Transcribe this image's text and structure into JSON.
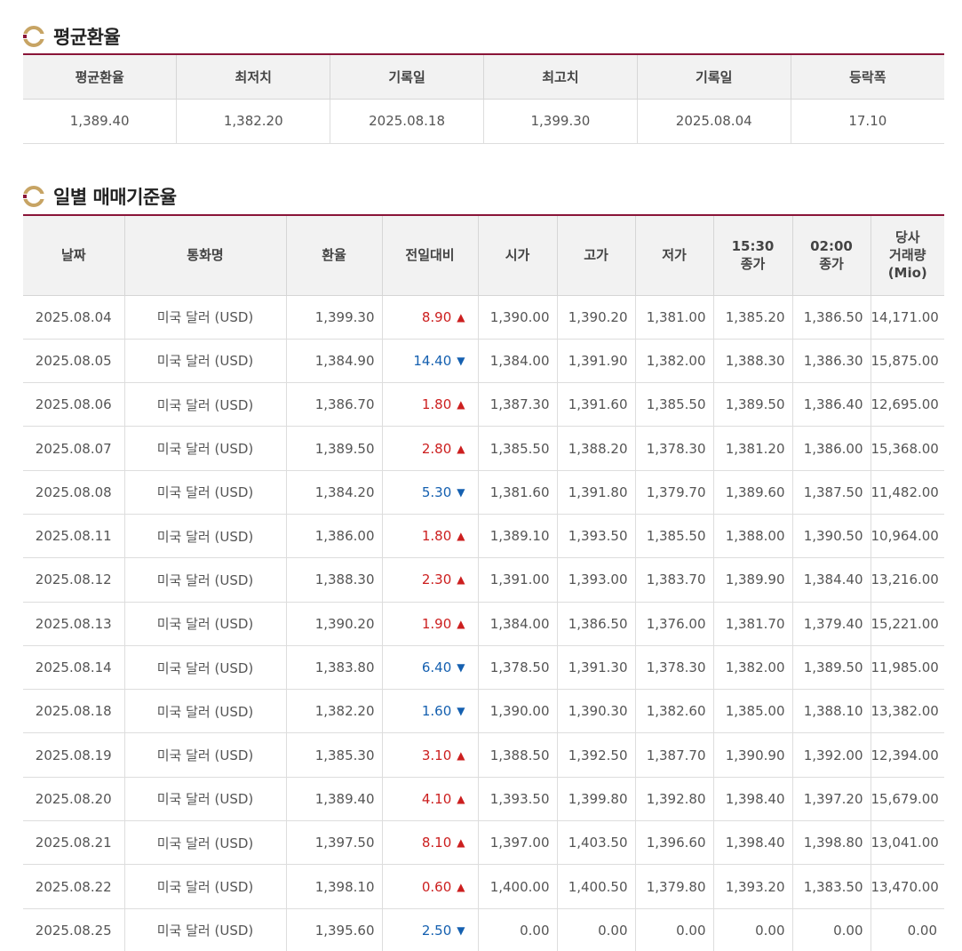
{
  "avg_section": {
    "title": "평균환율",
    "headers": [
      "평균환율",
      "최저치",
      "기록일",
      "최고치",
      "기록일",
      "등락폭"
    ],
    "values": [
      "1,389.40",
      "1,382.20",
      "2025.08.18",
      "1,399.30",
      "2025.08.04",
      "17.10"
    ]
  },
  "daily_section": {
    "title": "일별 매매기준율",
    "headers": [
      "날짜",
      "통화명",
      "환율",
      "전일대비",
      "시가",
      "고가",
      "저가",
      "15:30\n종가",
      "02:00\n종가",
      "당사\n거래량\n(Mio)"
    ],
    "rows": [
      {
        "date": "2025.08.04",
        "currency": "미국 달러 (USD)",
        "rate": "1,399.30",
        "change": "8.90",
        "dir": "up",
        "open": "1,390.00",
        "high": "1,390.20",
        "low": "1,381.00",
        "close1530": "1,385.20",
        "close0200": "1,386.50",
        "volume": "14,171.00"
      },
      {
        "date": "2025.08.05",
        "currency": "미국 달러 (USD)",
        "rate": "1,384.90",
        "change": "14.40",
        "dir": "down",
        "open": "1,384.00",
        "high": "1,391.90",
        "low": "1,382.00",
        "close1530": "1,388.30",
        "close0200": "1,386.30",
        "volume": "15,875.00"
      },
      {
        "date": "2025.08.06",
        "currency": "미국 달러 (USD)",
        "rate": "1,386.70",
        "change": "1.80",
        "dir": "up",
        "open": "1,387.30",
        "high": "1,391.60",
        "low": "1,385.50",
        "close1530": "1,389.50",
        "close0200": "1,386.40",
        "volume": "12,695.00"
      },
      {
        "date": "2025.08.07",
        "currency": "미국 달러 (USD)",
        "rate": "1,389.50",
        "change": "2.80",
        "dir": "up",
        "open": "1,385.50",
        "high": "1,388.20",
        "low": "1,378.30",
        "close1530": "1,381.20",
        "close0200": "1,386.00",
        "volume": "15,368.00"
      },
      {
        "date": "2025.08.08",
        "currency": "미국 달러 (USD)",
        "rate": "1,384.20",
        "change": "5.30",
        "dir": "down",
        "open": "1,381.60",
        "high": "1,391.80",
        "low": "1,379.70",
        "close1530": "1,389.60",
        "close0200": "1,387.50",
        "volume": "11,482.00"
      },
      {
        "date": "2025.08.11",
        "currency": "미국 달러 (USD)",
        "rate": "1,386.00",
        "change": "1.80",
        "dir": "up",
        "open": "1,389.10",
        "high": "1,393.50",
        "low": "1,385.50",
        "close1530": "1,388.00",
        "close0200": "1,390.50",
        "volume": "10,964.00"
      },
      {
        "date": "2025.08.12",
        "currency": "미국 달러 (USD)",
        "rate": "1,388.30",
        "change": "2.30",
        "dir": "up",
        "open": "1,391.00",
        "high": "1,393.00",
        "low": "1,383.70",
        "close1530": "1,389.90",
        "close0200": "1,384.40",
        "volume": "13,216.00"
      },
      {
        "date": "2025.08.13",
        "currency": "미국 달러 (USD)",
        "rate": "1,390.20",
        "change": "1.90",
        "dir": "up",
        "open": "1,384.00",
        "high": "1,386.50",
        "low": "1,376.00",
        "close1530": "1,381.70",
        "close0200": "1,379.40",
        "volume": "15,221.00"
      },
      {
        "date": "2025.08.14",
        "currency": "미국 달러 (USD)",
        "rate": "1,383.80",
        "change": "6.40",
        "dir": "down",
        "open": "1,378.50",
        "high": "1,391.30",
        "low": "1,378.30",
        "close1530": "1,382.00",
        "close0200": "1,389.50",
        "volume": "11,985.00"
      },
      {
        "date": "2025.08.18",
        "currency": "미국 달러 (USD)",
        "rate": "1,382.20",
        "change": "1.60",
        "dir": "down",
        "open": "1,390.00",
        "high": "1,390.30",
        "low": "1,382.60",
        "close1530": "1,385.00",
        "close0200": "1,388.10",
        "volume": "13,382.00"
      },
      {
        "date": "2025.08.19",
        "currency": "미국 달러 (USD)",
        "rate": "1,385.30",
        "change": "3.10",
        "dir": "up",
        "open": "1,388.50",
        "high": "1,392.50",
        "low": "1,387.70",
        "close1530": "1,390.90",
        "close0200": "1,392.00",
        "volume": "12,394.00"
      },
      {
        "date": "2025.08.20",
        "currency": "미국 달러 (USD)",
        "rate": "1,389.40",
        "change": "4.10",
        "dir": "up",
        "open": "1,393.50",
        "high": "1,399.80",
        "low": "1,392.80",
        "close1530": "1,398.40",
        "close0200": "1,397.20",
        "volume": "15,679.00"
      },
      {
        "date": "2025.08.21",
        "currency": "미국 달러 (USD)",
        "rate": "1,397.50",
        "change": "8.10",
        "dir": "up",
        "open": "1,397.00",
        "high": "1,403.50",
        "low": "1,396.60",
        "close1530": "1,398.40",
        "close0200": "1,398.80",
        "volume": "13,041.00"
      },
      {
        "date": "2025.08.22",
        "currency": "미국 달러 (USD)",
        "rate": "1,398.10",
        "change": "0.60",
        "dir": "up",
        "open": "1,400.00",
        "high": "1,400.50",
        "low": "1,379.80",
        "close1530": "1,393.20",
        "close0200": "1,383.50",
        "volume": "13,470.00"
      },
      {
        "date": "2025.08.25",
        "currency": "미국 달러 (USD)",
        "rate": "1,395.60",
        "change": "2.50",
        "dir": "down",
        "open": "0.00",
        "high": "0.00",
        "low": "0.00",
        "close1530": "0.00",
        "close0200": "0.00",
        "volume": "0.00"
      }
    ]
  },
  "colors": {
    "accent": "#8a1538",
    "up": "#cc1f1f",
    "down": "#1560b0",
    "icon_gold": "#c7a464",
    "icon_red": "#8a1538"
  },
  "icons": {
    "section": "ring-bullet-icon",
    "up": "triangle-up-icon",
    "down": "triangle-down-icon"
  }
}
